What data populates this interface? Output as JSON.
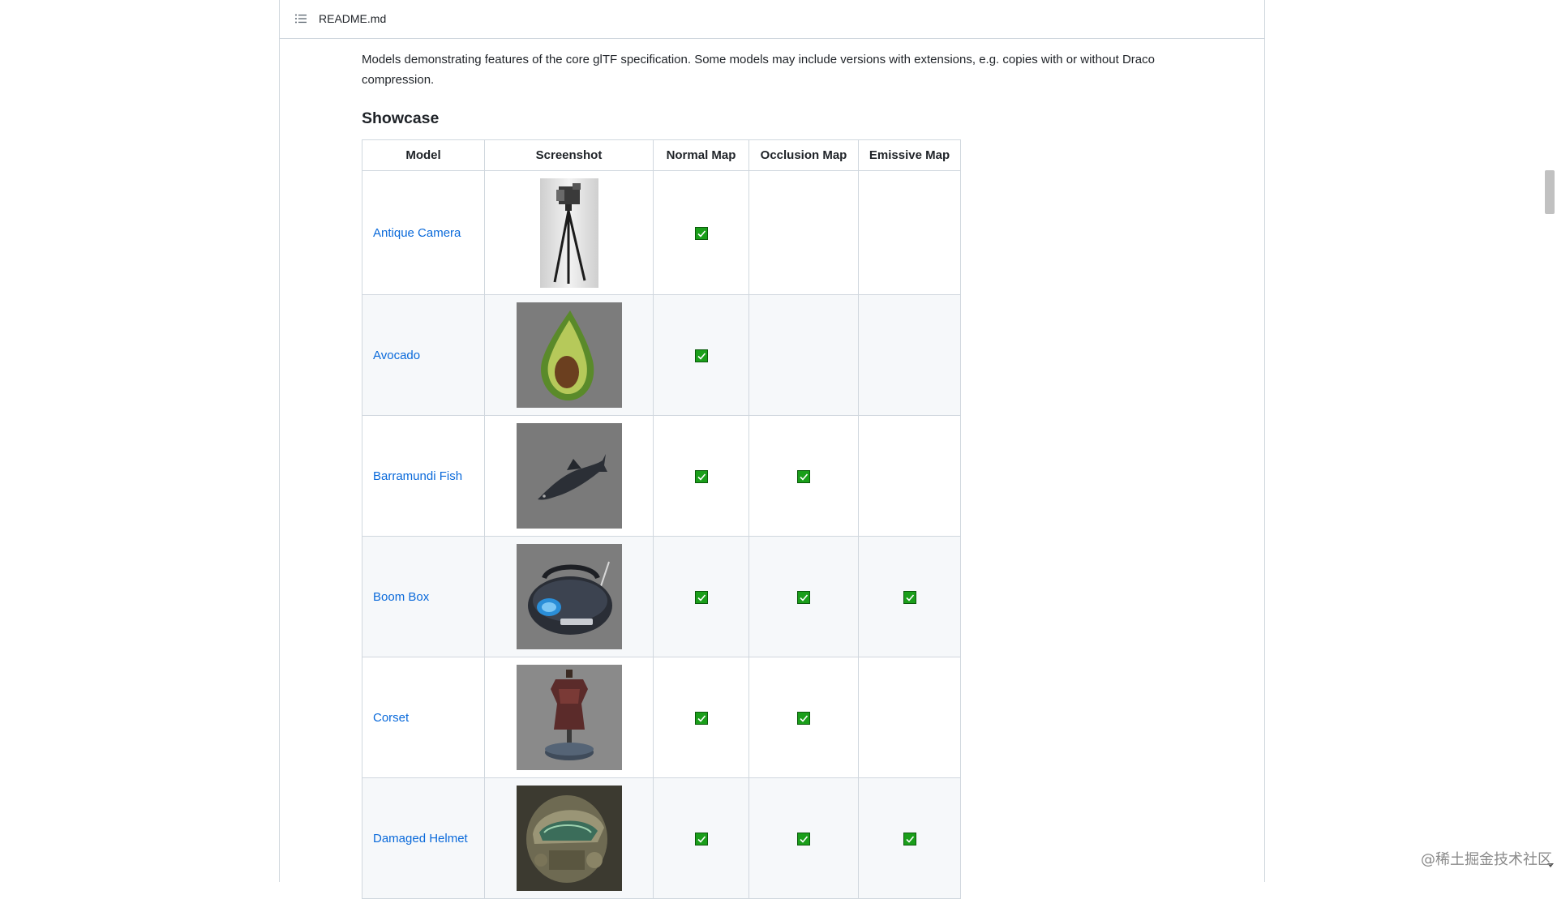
{
  "readme": {
    "filename": "README.md"
  },
  "intro_text": "Models demonstrating features of the core glTF specification. Some models may include versions with extensions, e.g. copies with or without Draco compression.",
  "section_heading": "Showcase",
  "table": {
    "headers": [
      "Model",
      "Screenshot",
      "Normal Map",
      "Occlusion Map",
      "Emissive Map"
    ],
    "rows": [
      {
        "model": "Antique Camera",
        "thumbnail": "camera-thumbnail",
        "normal_map": true,
        "occlusion_map": false,
        "emissive_map": false
      },
      {
        "model": "Avocado",
        "thumbnail": "avocado-thumbnail",
        "normal_map": true,
        "occlusion_map": false,
        "emissive_map": false
      },
      {
        "model": "Barramundi Fish",
        "thumbnail": "fish-thumbnail",
        "normal_map": true,
        "occlusion_map": true,
        "emissive_map": false
      },
      {
        "model": "Boom Box",
        "thumbnail": "boombox-thumbnail",
        "normal_map": true,
        "occlusion_map": true,
        "emissive_map": true
      },
      {
        "model": "Corset",
        "thumbnail": "corset-thumbnail",
        "normal_map": true,
        "occlusion_map": true,
        "emissive_map": false
      },
      {
        "model": "Damaged Helmet",
        "thumbnail": "helmet-thumbnail",
        "normal_map": true,
        "occlusion_map": true,
        "emissive_map": true
      }
    ]
  },
  "watermark": "@稀土掘金技术社区",
  "colors": {
    "link": "#0969da",
    "check": "#1a9e1a",
    "border": "#d0d7de",
    "stripe": "#f6f8fa"
  }
}
